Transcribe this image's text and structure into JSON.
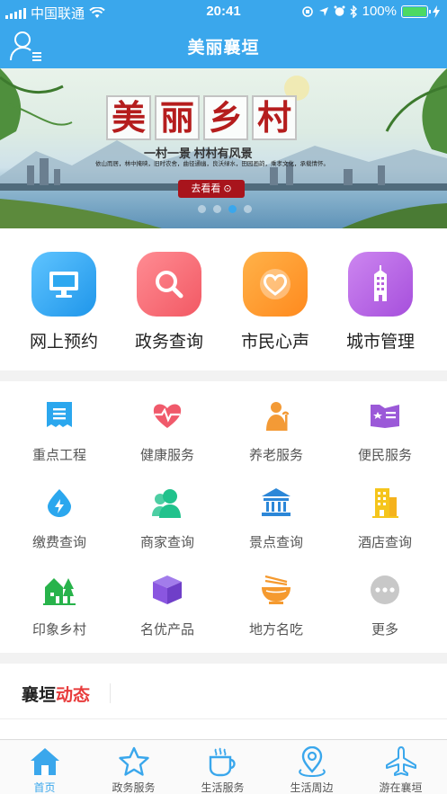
{
  "status_bar": {
    "carrier": "中国联通",
    "time": "20:41",
    "battery": "100%"
  },
  "header": {
    "title": "美丽襄垣"
  },
  "banner": {
    "title_chars": [
      "美",
      "丽",
      "乡",
      "村"
    ],
    "subtitle": "一村一景 村村有风景",
    "description": "依山而居，林中掩映，旧时农舍，曲径通幽，良沃绿水，田园画韵，乘孝文化，承载情怀。",
    "button_label": "去看看 ⊙",
    "slide_count": 4,
    "active_slide": 2
  },
  "quick_features": [
    {
      "label": "网上预约",
      "icon": "monitor-icon",
      "color": "#2ea8f0"
    },
    {
      "label": "政务查询",
      "icon": "search-icon",
      "color": "#f46a72"
    },
    {
      "label": "市民心声",
      "icon": "heart-icon",
      "color": "#ff9a2e"
    },
    {
      "label": "城市管理",
      "icon": "building-icon",
      "color": "#b561dd"
    }
  ],
  "services": [
    {
      "label": "重点工程",
      "icon": "list-icon",
      "color": "#2ba7ee"
    },
    {
      "label": "健康服务",
      "icon": "heartbeat-icon",
      "color": "#f05a6b"
    },
    {
      "label": "养老服务",
      "icon": "elder-icon",
      "color": "#f39a36"
    },
    {
      "label": "便民服务",
      "icon": "card-icon",
      "color": "#9b59d8"
    },
    {
      "label": "缴费查询",
      "icon": "drop-icon",
      "color": "#2ba7ee"
    },
    {
      "label": "商家查询",
      "icon": "people-icon",
      "color": "#21c28c"
    },
    {
      "label": "景点查询",
      "icon": "temple-icon",
      "color": "#2c87d8"
    },
    {
      "label": "酒店查询",
      "icon": "hotel-icon",
      "color": "#f5c51c"
    },
    {
      "label": "印象乡村",
      "icon": "village-icon",
      "color": "#28b34b"
    },
    {
      "label": "名优产品",
      "icon": "box-icon",
      "color": "#8a56e0"
    },
    {
      "label": "地方名吃",
      "icon": "noodle-icon",
      "color": "#f59a2f"
    },
    {
      "label": "更多",
      "icon": "more-icon",
      "color": "#c8c8c8"
    }
  ],
  "news": {
    "title_part1": "襄垣",
    "title_part2": "动态"
  },
  "tabs": [
    {
      "label": "首页",
      "icon": "home-icon",
      "active": true
    },
    {
      "label": "政务服务",
      "icon": "star-icon",
      "active": false
    },
    {
      "label": "生活服务",
      "icon": "coffee-icon",
      "active": false
    },
    {
      "label": "生活周边",
      "icon": "location-icon",
      "active": false
    },
    {
      "label": "游在襄垣",
      "icon": "plane-icon",
      "active": false
    }
  ],
  "colors": {
    "primary": "#3aa7ec",
    "news_highlight": "#e83c3c"
  }
}
